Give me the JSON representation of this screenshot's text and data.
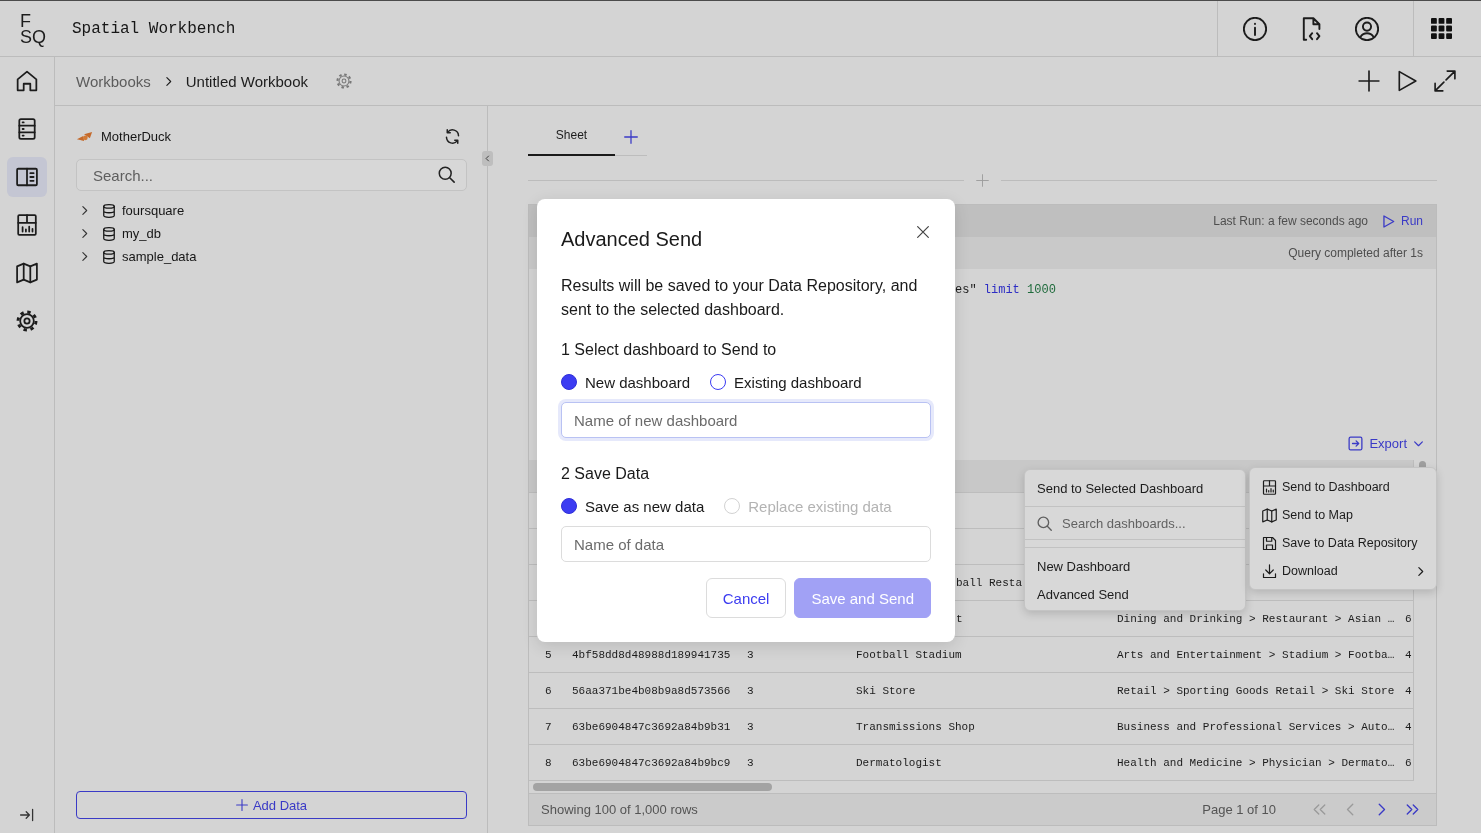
{
  "app_bar": {
    "logo_lines": [
      "F",
      "SQ"
    ],
    "title": "Spatial Workbench"
  },
  "nav_rail": {
    "items": [
      {
        "kind": "home",
        "selected": false
      },
      {
        "kind": "database",
        "selected": false
      },
      {
        "kind": "panels",
        "selected": true
      },
      {
        "kind": "dashboard",
        "selected": false
      },
      {
        "kind": "map",
        "selected": false
      },
      {
        "kind": "settings",
        "selected": false
      }
    ]
  },
  "breadcrumb": [
    "Workbooks",
    "Untitled Workbook"
  ],
  "data_panel": {
    "source": "MotherDuck",
    "search": {
      "placeholder": "Search..."
    },
    "tree": [
      {
        "label": "foursquare",
        "expanded": false
      },
      {
        "label": "my_db",
        "expanded": false
      },
      {
        "label": "sample_data",
        "expanded": false
      }
    ],
    "add_button": "Add Data"
  },
  "sheet_tabs": [
    {
      "label": "Sheet",
      "selected": true
    }
  ],
  "query": {
    "last_run": "Last Run: a few seconds ago",
    "run_button": "Run",
    "status": "Query completed after 1s",
    "code": [
      {
        "kind": "plain",
        "text": "es\""
      },
      {
        "kind": "keyword",
        "text": "limit"
      },
      {
        "kind": "number",
        "text": "1000"
      }
    ]
  },
  "results": {
    "export_button": "Export",
    "rows": [
      {
        "kind": "covered",
        "column_4": "ball Resta"
      },
      {
        "kind": "covered",
        "column_4": "t",
        "column_5": "Dining and Drinking > Restaurant > Asian …",
        "column_6": "6"
      },
      {
        "kind": "full",
        "column_1": "5",
        "column_2": "4bf58dd8d48988d189941735",
        "column_3": "3",
        "column_4": "Football Stadium",
        "column_5": "Arts and Entertainment > Stadium > Footba…",
        "column_6": "4"
      },
      {
        "kind": "full",
        "column_1": "6",
        "column_2": "56aa371be4b08b9a8d573566",
        "column_3": "3",
        "column_4": "Ski Store",
        "column_5": "Retail > Sporting Goods Retail > Ski Store",
        "column_6": "4"
      },
      {
        "kind": "full",
        "column_1": "7",
        "column_2": "63be6904847c3692a84b9b31",
        "column_3": "3",
        "column_4": "Transmissions Shop",
        "column_5": "Business and Professional Services > Auto…",
        "column_6": "4"
      },
      {
        "kind": "full",
        "column_1": "8",
        "column_2": "63be6904847c3692a84b9bc9",
        "column_3": "3",
        "column_4": "Dermatologist",
        "column_5": "Health and Medicine > Physician > Dermato…",
        "column_6": "6"
      }
    ],
    "summary": "Showing 100 of 1,000 rows",
    "page": "Page 1 of 10",
    "pager": [
      {
        "kind": "first",
        "disabled": true
      },
      {
        "kind": "previous",
        "disabled": true
      },
      {
        "kind": "next",
        "disabled": false
      },
      {
        "kind": "last",
        "disabled": false
      }
    ]
  },
  "send_menu": {
    "title": "Send to Selected Dashboard",
    "search": {
      "placeholder": "Search dashboards..."
    },
    "items": [
      "New Dashboard",
      "Advanced Send"
    ]
  },
  "export_menu": {
    "items": [
      {
        "kind": "dashboard",
        "label": "Send to Dashboard",
        "submenu": false
      },
      {
        "kind": "map",
        "label": "Send to Map",
        "submenu": false
      },
      {
        "kind": "save",
        "label": "Save to Data Repository",
        "submenu": false
      },
      {
        "kind": "download",
        "label": "Download",
        "submenu": true
      }
    ]
  },
  "modal": {
    "title": "Advanced Send",
    "description": "Results will be saved to your Data Repository, and sent to the selected dashboard.",
    "sections": [
      {
        "heading": "1 Select dashboard to Send to",
        "options": [
          {
            "label": "New dashboard",
            "selected": true,
            "disabled": false
          },
          {
            "label": "Existing dashboard",
            "selected": false,
            "disabled": false
          }
        ],
        "field": {
          "placeholder": "Name of new dashboard",
          "focused": true
        }
      },
      {
        "heading": "2 Save Data",
        "options": [
          {
            "label": "Save as new data",
            "selected": true,
            "disabled": false
          },
          {
            "label": "Replace existing data",
            "selected": false,
            "disabled": true
          }
        ],
        "field": {
          "placeholder": "Name of data",
          "focused": false
        }
      }
    ],
    "buttons": [
      {
        "label": "Cancel",
        "kind": "secondary",
        "disabled": false
      },
      {
        "label": "Save and Send",
        "kind": "primary",
        "disabled": true
      }
    ]
  }
}
